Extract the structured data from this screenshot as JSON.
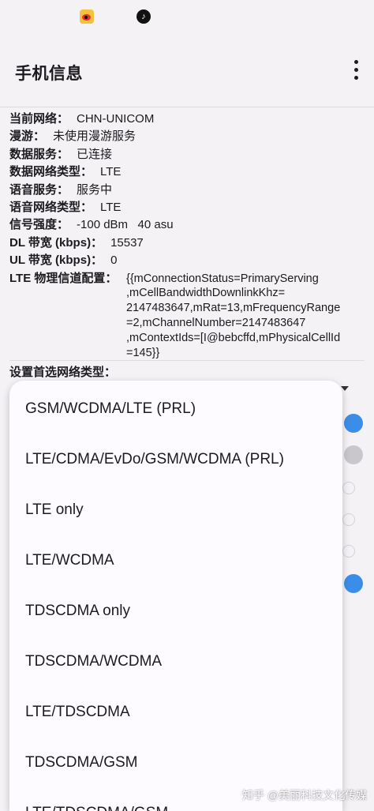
{
  "status_bar": {
    "icons": [
      "weibo-icon",
      "tiktok-icon"
    ],
    "tiktok_glyph": "♪"
  },
  "app_bar": {
    "title": "手机信息",
    "menu_icon": "more-vert-icon"
  },
  "info": {
    "current_network": {
      "label": "当前网络：",
      "value": "CHN-UNICOM"
    },
    "roaming": {
      "label": "漫游：",
      "value": "未使用漫游服务"
    },
    "data_service": {
      "label": "数据服务：",
      "value": "已连接"
    },
    "data_network_type": {
      "label": "数据网络类型：",
      "value": "LTE"
    },
    "voice_service": {
      "label": "语音服务：",
      "value": "服务中"
    },
    "voice_network_type": {
      "label": "语音网络类型：",
      "value": "LTE"
    },
    "signal_strength": {
      "label": "信号强度：",
      "value": "-100 dBm   40 asu"
    },
    "dl_bandwidth": {
      "label": "DL 带宽 (kbps)：",
      "value": "15537"
    },
    "ul_bandwidth": {
      "label": "UL 带宽 (kbps)：",
      "value": "0"
    },
    "lte_channel_config": {
      "label": "LTE 物理信道配置：",
      "lines": [
        "{{mConnectionStatus=PrimaryServing",
        ",mCellBandwidthDownlinkKhz=",
        "2147483647,mRat=13,mFrequencyRange",
        "=2,mChannelNumber=2147483647",
        ",mContextIds=[I@bebcffd,mPhysicalCellId",
        "=145}}"
      ]
    }
  },
  "preferred_network": {
    "label": "设置首选网络类型：",
    "options": [
      "GSM/WCDMA/LTE (PRL)",
      "LTE/CDMA/EvDo/GSM/WCDMA (PRL)",
      "LTE only",
      "LTE/WCDMA",
      "TDSCDMA only",
      "TDSCDMA/WCDMA",
      "LTE/TDSCDMA",
      "TDSCDMA/GSM",
      "LTE/TDSCDMA/GSM"
    ]
  },
  "colors": {
    "accent": "#3b8ee8",
    "background": "#f5f2f6",
    "popup": "#fdfbff"
  },
  "watermark": "知乎 @美丽科技文化传媒"
}
